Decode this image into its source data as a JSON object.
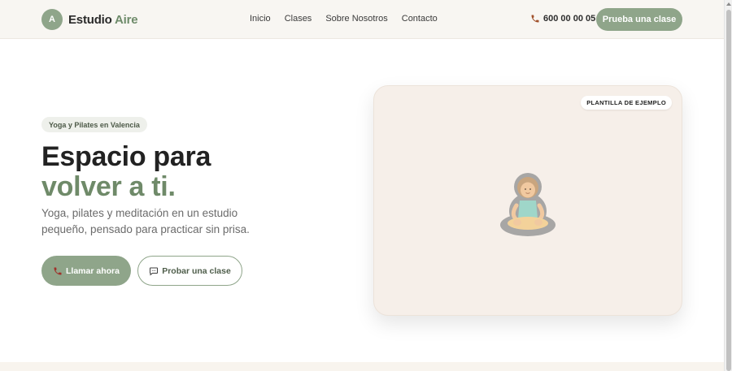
{
  "brand": {
    "mark": "A",
    "name_main": "Estudio",
    "name_accent": "Aire",
    "accent_color": "#6e8b6a"
  },
  "nav": {
    "items": [
      "Inicio",
      "Clases",
      "Sobre Nosotros",
      "Contacto"
    ]
  },
  "header": {
    "phone": "600 00 00 05",
    "cta_label": "Prueba una clase"
  },
  "hero": {
    "badge": "Yoga y Pilates en Valencia",
    "headline_line1": "Espacio para",
    "headline_line2": "volver a ti.",
    "subtitle": "Yoga, pilates y meditación en un estudio pequeño, pensado para practicar sin prisa.",
    "primary_button": "Llamar ahora",
    "secondary_button": "Probar una clase"
  },
  "card": {
    "tag": "PLANTILLA DE EJEMPLO",
    "illustration": "meditating-person-icon"
  },
  "colors": {
    "primary": "#8fa58a",
    "card_bg": "#f6efe9",
    "header_bg": "#f8f6f2"
  }
}
